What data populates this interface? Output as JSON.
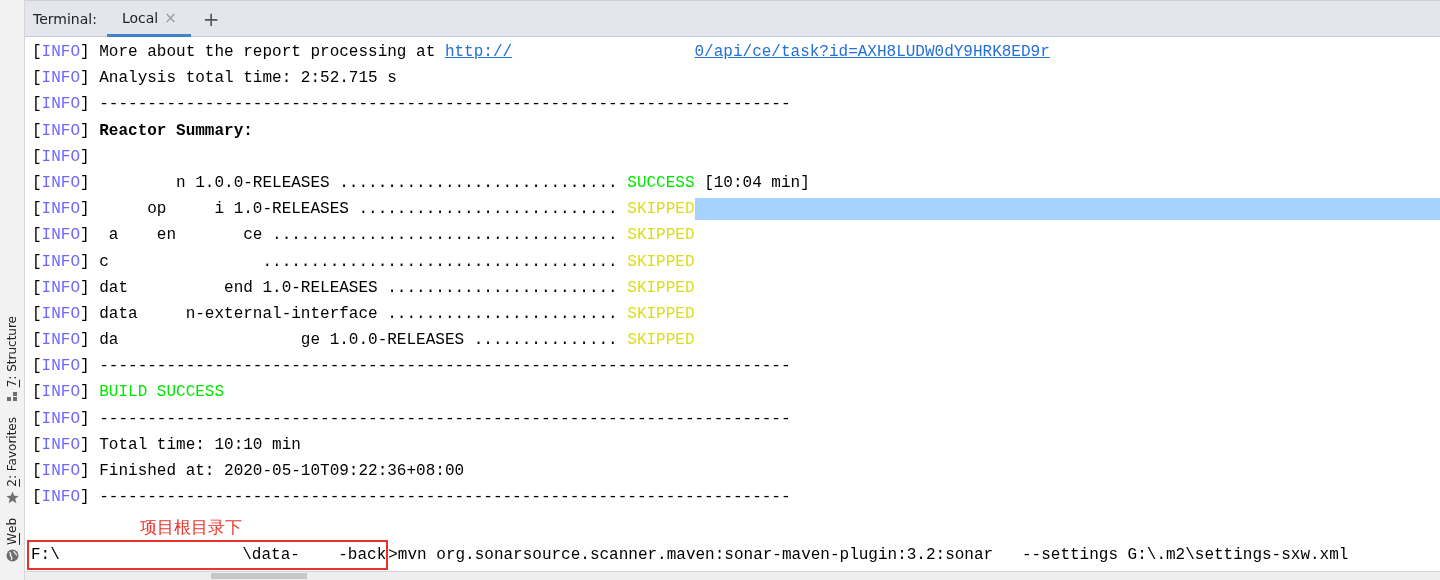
{
  "tab_bar": {
    "label": "Terminal:",
    "tabs": [
      {
        "label": "Local",
        "selected": true,
        "close": "×"
      }
    ],
    "add": "+"
  },
  "side_tools": [
    {
      "kind": "structure",
      "label": "7: Structure"
    },
    {
      "kind": "favorites",
      "label": "2: Favorites"
    },
    {
      "kind": "web",
      "label": "Web"
    }
  ],
  "lines": [
    {
      "tag": "[INFO]",
      "selected": false,
      "segments": [
        {
          "kind": "text",
          "text": "More about the report processing at "
        },
        {
          "kind": "link",
          "text": "http://"
        },
        {
          "kind": "link_after_gap",
          "text": "0/api/ce/task?id=AXH8LUDW0dY9HRK8ED9r"
        }
      ]
    },
    {
      "tag": "[INFO]",
      "selected": false,
      "segments": [
        {
          "kind": "text",
          "text": "Analysis total time: 2:52.715 s"
        }
      ]
    },
    {
      "tag": "[INFO]",
      "selected": false,
      "segments": [
        {
          "kind": "text",
          "text": "------------------------------------------------------------------------"
        }
      ]
    },
    {
      "tag": "[INFO]",
      "selected": false,
      "segments": [
        {
          "kind": "bold",
          "text": "Reactor Summary:"
        }
      ]
    },
    {
      "tag": "[INFO]",
      "selected": false
    },
    {
      "tag": "[INFO]",
      "selected": false,
      "segments": [
        {
          "kind": "text",
          "text": "        n 1.0.0-RELEASES ............................. "
        },
        {
          "kind": "success",
          "text": "SUCCESS"
        },
        {
          "kind": "text",
          "text": " [10:04 min]"
        }
      ]
    },
    {
      "tag": "[INFO]",
      "selected": true,
      "segments": [
        {
          "kind": "text",
          "text": "     op     i 1.0-RELEASES ........................... "
        },
        {
          "kind": "skipped",
          "text": "SKIPPED"
        }
      ]
    },
    {
      "tag": "[INFO]",
      "selected": false,
      "segments": [
        {
          "kind": "text",
          "text": " a    en       ce .................................... "
        },
        {
          "kind": "skipped",
          "text": "SKIPPED"
        }
      ]
    },
    {
      "tag": "[INFO]",
      "selected": false,
      "segments": [
        {
          "kind": "text",
          "text": "c                ..................................... "
        },
        {
          "kind": "skipped",
          "text": "SKIPPED"
        }
      ]
    },
    {
      "tag": "[INFO]",
      "selected": false,
      "segments": [
        {
          "kind": "text",
          "text": "dat          end 1.0-RELEASES ........................ "
        },
        {
          "kind": "skipped",
          "text": "SKIPPED"
        }
      ]
    },
    {
      "tag": "[INFO]",
      "selected": false,
      "segments": [
        {
          "kind": "text",
          "text": "data     n-external-interface ........................ "
        },
        {
          "kind": "skipped",
          "text": "SKIPPED"
        }
      ]
    },
    {
      "tag": "[INFO]",
      "selected": false,
      "segments": [
        {
          "kind": "text",
          "text": "da                   ge 1.0.0-RELEASES ............... "
        },
        {
          "kind": "skipped",
          "text": "SKIPPED"
        }
      ]
    },
    {
      "tag": "[INFO]",
      "selected": false,
      "segments": [
        {
          "kind": "text",
          "text": "------------------------------------------------------------------------"
        }
      ]
    },
    {
      "tag": "[INFO]",
      "selected": false,
      "segments": [
        {
          "kind": "success",
          "text": "BUILD SUCCESS"
        }
      ]
    },
    {
      "tag": "[INFO]",
      "selected": false,
      "segments": [
        {
          "kind": "text",
          "text": "------------------------------------------------------------------------"
        }
      ]
    },
    {
      "tag": "[INFO]",
      "selected": false,
      "segments": [
        {
          "kind": "text",
          "text": "Total time: 10:10 min"
        }
      ]
    },
    {
      "tag": "[INFO]",
      "selected": false,
      "segments": [
        {
          "kind": "text",
          "text": "Finished at: 2020-05-10T09:22:36+08:00"
        }
      ]
    },
    {
      "tag": "[INFO]",
      "selected": false,
      "segments": [
        {
          "kind": "text",
          "text": "------------------------------------------------------------------------"
        }
      ]
    }
  ],
  "annotation": "项目根目录下",
  "prompt": {
    "path": "F:\\                   \\data-    -back",
    "command": ">mvn org.sonarsource.scanner.maven:sonar-maven-plugin:3.2:sonar   --settings G:\\.m2\\settings-sxw.xml"
  }
}
